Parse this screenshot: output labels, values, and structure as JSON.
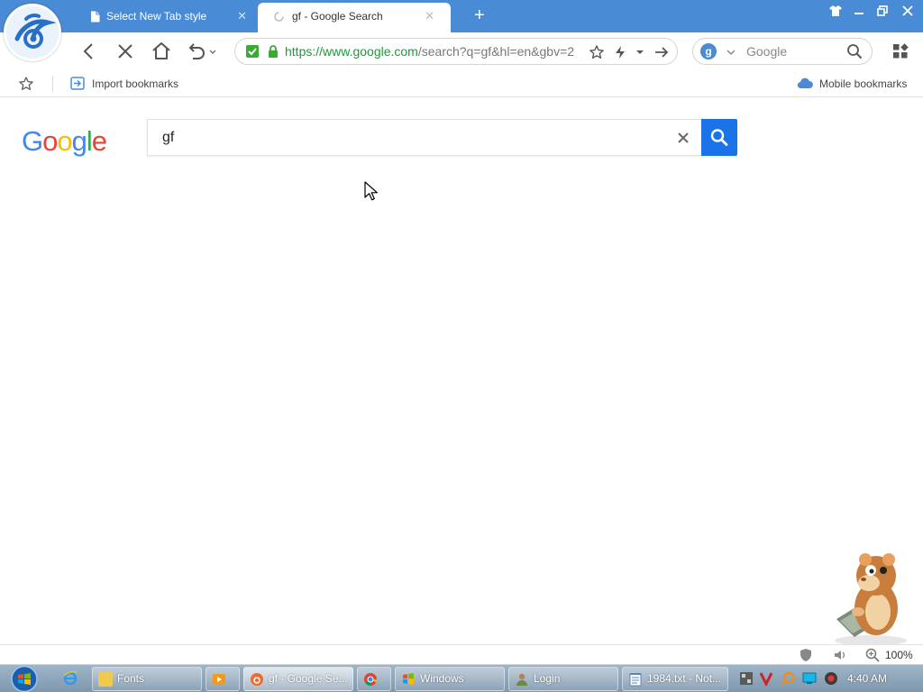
{
  "browser": {
    "tabs": [
      {
        "title": "Select New Tab style",
        "active": false
      },
      {
        "title": "gf - Google Search",
        "active": true
      }
    ],
    "address": {
      "url_host": "https://www.google.com",
      "url_rest": "/search?q=gf&hl=en&gbv=2"
    },
    "search_engine": "Google",
    "colors": {
      "tabstrip": "#4a8bd6",
      "secure": "#3aaa35",
      "url_host": "#1a9a3a"
    }
  },
  "bookmarks": {
    "import_label": "Import bookmarks",
    "mobile_label": "Mobile bookmarks"
  },
  "page": {
    "logo_letters": [
      "G",
      "o",
      "o",
      "g",
      "l",
      "e"
    ],
    "logo_colors": [
      "#4285f4",
      "#ea4335",
      "#fbbc05",
      "#4285f4",
      "#34a853",
      "#ea4335"
    ],
    "query": "gf",
    "search_button_color": "#1a73e8"
  },
  "status": {
    "zoom": "100%"
  },
  "taskbar": {
    "items": [
      {
        "label": "Fonts"
      },
      {
        "label": "gf - Google Se..."
      },
      {
        "label": "Windows"
      },
      {
        "label": "Login"
      },
      {
        "label": "1984.txt - Not..."
      }
    ],
    "clock": "4:40 AM"
  }
}
